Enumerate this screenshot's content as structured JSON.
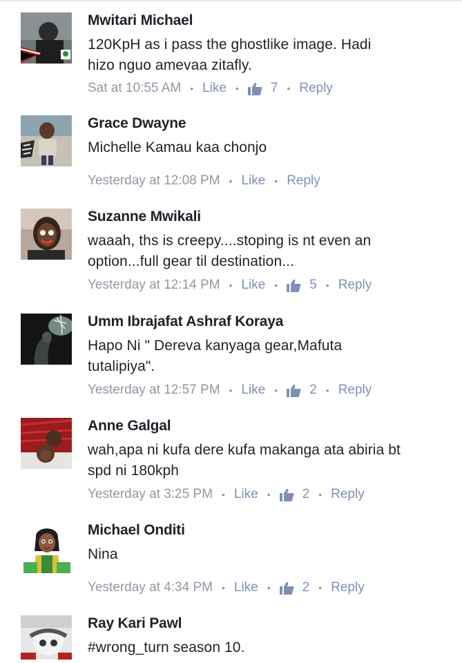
{
  "comments": [
    {
      "name": "Mwitari Michael",
      "lines": [
        "120KpH as i pass the ghostlike image. Hadi",
        "hizo nguo amevaa zitafly."
      ],
      "time": "Sat at 10:55 AM",
      "like_label": "Like",
      "like_count": "7",
      "reply_label": "Reply"
    },
    {
      "name": "Grace Dwayne",
      "mention": "Michelle Kamau",
      "lines": [
        " kaa chonjo"
      ],
      "time": "Yesterday at 12:08 PM",
      "like_label": "Like",
      "reply_label": "Reply"
    },
    {
      "name": "Suzanne Mwikali",
      "lines": [
        "waaah, ths is creepy....stoping is nt even an",
        "option...full gear til destination..."
      ],
      "time": "Yesterday at 12:14 PM",
      "like_label": "Like",
      "like_count": "5",
      "reply_label": "Reply"
    },
    {
      "name": "Umm Ibrajafat Ashraf Koraya",
      "lines": [
        "Hapo Ni \" Dereva kanyaga gear,Mafuta",
        "tutalipiya\"."
      ],
      "time": "Yesterday at 12:57 PM",
      "like_label": "Like",
      "like_count": "2",
      "reply_label": "Reply"
    },
    {
      "name": "Anne Galgal",
      "lines": [
        "wah,apa ni kufa dere kufa makanga ata abiria bt",
        "spd ni 180kph"
      ],
      "time": "Yesterday at 3:25 PM",
      "like_label": "Like",
      "like_count": "2",
      "reply_label": "Reply"
    },
    {
      "name": "Michael Onditi",
      "lines": [
        "Nina"
      ],
      "time": "Yesterday at 4:34 PM",
      "like_label": "Like",
      "like_count": "2",
      "reply_label": "Reply"
    },
    {
      "name": "Ray Kari Pawl",
      "lines": [
        "#wrong_turn season 10."
      ]
    }
  ],
  "colors": {
    "name": "#1d2129",
    "meta": "#9197a3",
    "link": "#7f8fb5"
  }
}
